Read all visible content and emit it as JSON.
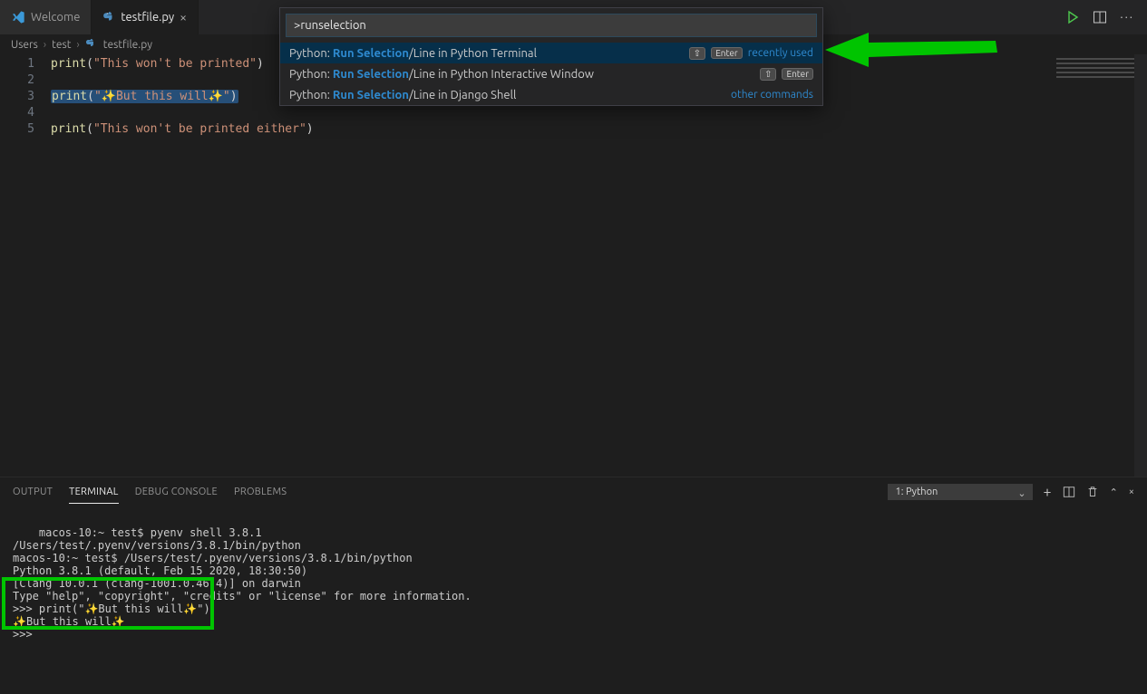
{
  "tabs": {
    "welcome": "Welcome",
    "file": "testfile.py"
  },
  "breadcrumbs": {
    "part1": "Users",
    "part2": "test",
    "part3": "testfile.py"
  },
  "editor": {
    "lines": [
      {
        "n": "1",
        "prefix": "print(",
        "str": "\"This won't be printed\"",
        "suffix": ")"
      },
      {
        "n": "2",
        "prefix": "",
        "str": "",
        "suffix": ""
      },
      {
        "n": "3",
        "prefix": "print(",
        "str": "\"✨But this will✨\"",
        "suffix": ")",
        "selected": true
      },
      {
        "n": "4",
        "prefix": "",
        "str": "",
        "suffix": ""
      },
      {
        "n": "5",
        "prefix": "print(",
        "str": "\"This won't be printed either\"",
        "suffix": ")"
      }
    ]
  },
  "palette": {
    "input": ">runselection",
    "items": [
      {
        "prefix": "Python: ",
        "match": "Run Selection",
        "suffix": "/Line in Python Terminal",
        "keys": [
          "⇧",
          "Enter"
        ],
        "meta": "recently used",
        "hl": true
      },
      {
        "prefix": "Python: ",
        "match": "Run Selection",
        "suffix": "/Line in Python Interactive Window",
        "keys": [
          "⇧",
          "Enter"
        ],
        "meta": ""
      },
      {
        "prefix": "Python: ",
        "match": "Run Selection",
        "suffix": "/Line in Django Shell",
        "keys": [],
        "meta": "other commands"
      }
    ]
  },
  "panel": {
    "tabs": {
      "output": "OUTPUT",
      "terminal": "TERMINAL",
      "debug": "DEBUG CONSOLE",
      "problems": "PROBLEMS"
    },
    "terminalSelect": "1: Python",
    "terminal": "macos-10:~ test$ pyenv shell 3.8.1\n/Users/test/.pyenv/versions/3.8.1/bin/python\nmacos-10:~ test$ /Users/test/.pyenv/versions/3.8.1/bin/python\nPython 3.8.1 (default, Feb 15 2020, 18:30:50)\n[Clang 10.0.1 (clang-1001.0.46.4)] on darwin\nType \"help\", \"copyright\", \"credits\" or \"license\" for more information.\n>>> print(\"✨But this will✨\")\n✨But this will✨\n>>> "
  },
  "colors": {
    "accent": "#2e8ad0",
    "green": "#00c400"
  }
}
